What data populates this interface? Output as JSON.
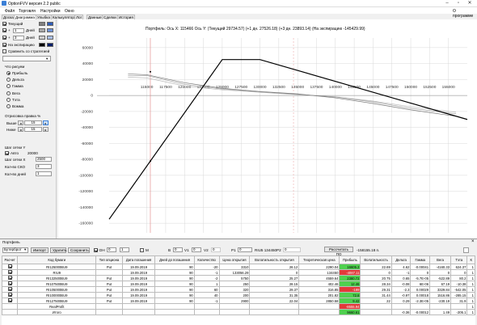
{
  "window": {
    "title": "OptionFVV версия 2.2 public",
    "about": "О программе"
  },
  "menu": [
    "Файл",
    "Торговля",
    "Настройки",
    "Окно"
  ],
  "tabs": [
    "Доска",
    "Диаграмма",
    "Улыбка",
    "Калькулятор",
    "Лог",
    "Данные",
    "Сделки",
    "История"
  ],
  "left": {
    "rows": [
      {
        "label": "Текущий",
        "checked": true
      },
      {
        "label": "+",
        "value": "1",
        "unit": "Дней",
        "checked": true
      },
      {
        "label": "+",
        "value": "3",
        "unit": "Дней",
        "checked": true
      },
      {
        "label": "На экспирацию",
        "checked": true
      }
    ],
    "compare_label": "Сравнить со стратегией",
    "what_label": "Что рисуем",
    "radios": [
      "Прибыль",
      "Дельта",
      "Гамма",
      "Вега",
      "Тэта",
      "Вомма"
    ],
    "draw_edge_label": "Отрисовка правка %",
    "upper_label": "Выше",
    "upper_value": "15",
    "lower_label": "Ниже",
    "lower_value": "15",
    "step_y_label": "Шаг сетки Y",
    "auto_label": "Авто",
    "auto_value": "20000",
    "step_x_label": "Шаг сетки X",
    "step_x_value": "2500",
    "sko_label": "Кол-во СКО",
    "sko_value": "3",
    "days_label": "Кол-во дней",
    "days_value": "1"
  },
  "chart_header": "Портфель: Ось X: 115466 Ось Y: (Текущий 29734.57) (+1 дн. 27526.18) (+3 дн. 23893.14) (На экспирацию -145429.99)",
  "chart_data": {
    "type": "line",
    "x_ticks": [
      "115000",
      "117500",
      "120000",
      "122500",
      "125000",
      "127500",
      "130000",
      "132500",
      "135000",
      "137500",
      "140000",
      "142500",
      "145000",
      "147500",
      "150000",
      "152500",
      "155000"
    ],
    "y_ticks": [
      "60000",
      "40000",
      "20000",
      "0",
      "-20000",
      "-40000",
      "-60000",
      "-80000",
      "-100000",
      "-120000",
      "-140000",
      "-160000"
    ],
    "xlim": [
      110000,
      157500
    ],
    "ylim": [
      -172000,
      72000
    ],
    "cursor_x": 115466,
    "series": [
      {
        "x": [
          110000,
          125000,
          130000,
          157500
        ],
        "y": [
          -155000,
          45000,
          45000,
          -30000
        ],
        "color": "#000000"
      },
      {
        "x": [
          112500,
          115000,
          120000,
          125000,
          130000,
          135000,
          140000,
          145000,
          150000,
          156000
        ],
        "y": [
          27000,
          26000,
          16000,
          9000,
          5000,
          2000,
          -3000,
          -10000,
          -18000,
          -26000
        ],
        "color": "#777777"
      },
      {
        "x": [
          112500,
          115000,
          120000,
          125000,
          130000,
          135000,
          140000,
          145000,
          150000,
          156000
        ],
        "y": [
          25000,
          25000,
          14000,
          8000,
          4500,
          1500,
          -2000,
          -8000,
          -16000,
          -23000
        ],
        "color": "#999999"
      },
      {
        "x": [
          112500,
          115000,
          120000,
          125000,
          130000,
          135000,
          140000,
          145000,
          150000,
          156000
        ],
        "y": [
          23000,
          22000,
          12000,
          7000,
          4000,
          1000,
          -1500,
          -7000,
          -14000,
          -21000
        ],
        "color": "#bbbbbb"
      }
    ]
  },
  "portfolio": {
    "title": "Портфель",
    "select_value": "Бутерброт",
    "buttons": [
      "Импорт",
      "Удалить",
      "Сохранить"
    ],
    "dh_label": "DH",
    "dh_value": "0",
    "dh2_value": "1",
    "m_label": "M",
    "b_label": "B",
    "b_value": "0",
    "v1_label": "V1",
    "v1_value": "0",
    "v2_label": "V2",
    "v2_value": "0",
    "p1_label": "P1",
    "p1_value": "0",
    "ticker": "RIU5 134450",
    "p2_label": "P2",
    "p2_value": "0",
    "calc_button": "Рассчитать ПО",
    "calc_result": "-158155.18 п.",
    "columns": [
      "Расчет",
      "Код бумаги",
      "Тип опциона",
      "Дата погашения",
      "Дней до погашения",
      "Количество",
      "Цена открытия",
      "Волатильность открытия",
      "Теоретическая цена",
      "Прибыль",
      "Волатильность",
      "Дельта",
      "Гамма",
      "Вега",
      "Тэта",
      "К"
    ],
    "rows": [
      [
        "",
        "RI125000BU9",
        "Put",
        "19.09.2019",
        "90",
        "-20",
        "3310",
        "26.12",
        "2290.04",
        "16605.2",
        "22.69",
        "4.62",
        "-0.00041",
        "-4160.33",
        "624.37",
        "1"
      ],
      [
        "",
        "RIU9",
        "",
        "19.09.2019",
        "90",
        "-1",
        "133056.29",
        "0",
        "134450",
        "-4087.11",
        "0",
        "-1",
        "0",
        "0",
        "0",
        "1"
      ],
      [
        "",
        "RI132500BU9",
        "Put",
        "19.09.2019",
        "90",
        "-2",
        "5750",
        "25.27",
        "4559.64",
        "2380.72",
        "20.75",
        "0.65",
        "-5.7E-05",
        "-522.89",
        "80.2",
        "1"
      ],
      [
        "",
        "RI107500BU9",
        "Put",
        "19.09.2019",
        "90",
        "1",
        "250",
        "28.15",
        "402.46",
        "12.46",
        "28.34",
        "-0.08",
        "6E-06",
        "67.19",
        "-10.38",
        "1"
      ],
      [
        "",
        "RI105000BU9",
        "Put",
        "19.09.2019",
        "90",
        "60",
        "320",
        "29.37",
        "316.85",
        "-189",
        "29.31",
        "-2.3",
        "0.00029",
        "3329.84",
        "-542.05",
        "1"
      ],
      [
        "",
        "RI100000BU9",
        "Put",
        "19.09.2019",
        "90",
        "40",
        "200",
        "31.35",
        "201.82",
        "72.8",
        "31.44",
        "-0.97",
        "0.00018",
        "1516.86",
        "-285.15",
        "1"
      ],
      [
        "",
        "RI127500BU9",
        "Put",
        "19.09.2019",
        "90",
        "-1",
        "2900",
        "22.04",
        "2850.58",
        "9.42",
        "22",
        "0.29",
        "-2.3E-05",
        "-230.19",
        "31.9",
        "1"
      ],
      [
        "",
        "RealProfit",
        "",
        "",
        "",
        "",
        "",
        "",
        "",
        "-8555.94",
        "",
        "",
        "",
        "",
        "",
        "1"
      ],
      [
        "",
        "Итого",
        "",
        "",
        "",
        "",
        "",
        "",
        "",
        "9660.61",
        "",
        "-0.36",
        "-0.00012",
        "1.49",
        "-205.1",
        "1"
      ]
    ],
    "profit_colors": [
      "g",
      "r",
      "g",
      "g",
      "r",
      "g",
      "g",
      "r",
      "g"
    ]
  }
}
